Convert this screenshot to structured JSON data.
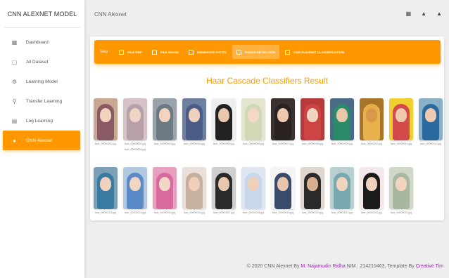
{
  "sidebar": {
    "brand": "CNN ALEXNET MODEL",
    "items": [
      {
        "label": "Dashboard",
        "icon": "dashboard-icon",
        "glyph": "▦"
      },
      {
        "label": "All Dataset",
        "icon": "document-icon",
        "glyph": "▢"
      },
      {
        "label": "Learning Model",
        "icon": "learning-icon",
        "glyph": "⚙"
      },
      {
        "label": "Transfer Learning",
        "icon": "location-pin-icon",
        "glyph": "⚲"
      },
      {
        "label": "Log Learning",
        "icon": "log-icon",
        "glyph": "▤"
      },
      {
        "label": "CNN Alexnet",
        "icon": "person-icon",
        "glyph": "●"
      }
    ]
  },
  "header": {
    "title": "CNN Alexnet",
    "icons": [
      "apps-icon",
      "notifications-icon",
      "user-icon"
    ],
    "icon_glyphs": [
      "▦",
      "▲",
      "▲"
    ]
  },
  "steps": {
    "label": "Step",
    "items": [
      "FILE PDF",
      "FILE IMAGE",
      "GENERATE FACES",
      "FACES DETECTION",
      "CNN ALEXNET CLASSIFICATION"
    ],
    "active_index": 3
  },
  "result": {
    "title": "Haar Cascade Classifiers Result",
    "row1": [
      {
        "caption": "face_00000001.jpg",
        "caption2": ""
      },
      {
        "caption": "face_00000002.jpg",
        "caption2": "face_00000003.jpg"
      },
      {
        "caption": "face_00000003.jpg",
        "caption2": ""
      },
      {
        "caption": "face_00000004.jpg",
        "caption2": ""
      },
      {
        "caption": "face_00000005.jpg",
        "caption2": ""
      },
      {
        "caption": "face_00000006.jpg",
        "caption2": ""
      },
      {
        "caption": "face_00000007.jpg",
        "caption2": ""
      },
      {
        "caption": "face_00000008.jpg",
        "caption2": ""
      },
      {
        "caption": "face_00000009.jpg",
        "caption2": ""
      },
      {
        "caption": "face_00000010.jpg",
        "caption2": ""
      },
      {
        "caption": "face_00000011.jpg",
        "caption2": ""
      },
      {
        "caption": "face_00000012.jpg",
        "caption2": ""
      }
    ],
    "row2": [
      {
        "caption": "face_00000013.jpg"
      },
      {
        "caption": "face_00000014.jpg"
      },
      {
        "caption": "face_00000015.jpg"
      },
      {
        "caption": "face_00000016.jpg"
      },
      {
        "caption": "face_00000017.jpg"
      },
      {
        "caption": "face_00000018.jpg"
      },
      {
        "caption": "face_00000019.jpg"
      },
      {
        "caption": "face_00000020.jpg"
      },
      {
        "caption": "face_00000021.jpg"
      },
      {
        "caption": "face_00000022.jpg"
      },
      {
        "caption": "face_00000023.jpg"
      }
    ]
  },
  "footer": {
    "prefix": "© 2020 CNN Alexnet By ",
    "author": "M. Najamudin Ridha",
    "middle": " NIM : 214210463, Template By ",
    "template": "Creative Tim"
  },
  "colors": {
    "accent": "#ff9800",
    "link": "#9c27b0"
  }
}
